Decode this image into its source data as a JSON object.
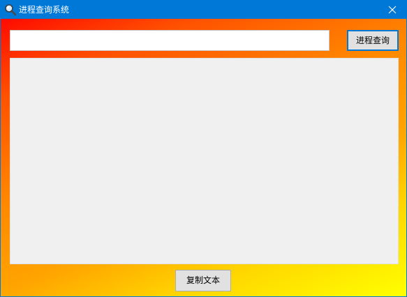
{
  "window": {
    "title": "进程查询系统",
    "icon": "magnifier-icon",
    "close_icon": "close-icon"
  },
  "query": {
    "input_value": "",
    "button_label": "进程查询"
  },
  "result": {
    "text": ""
  },
  "actions": {
    "copy_label": "复制文本"
  },
  "colors": {
    "titlebar": "#0078d7",
    "gradient_start": "#ff0a00",
    "gradient_mid": "#ff8800",
    "gradient_end": "#ffff00",
    "result_background": "#f0f0f0"
  }
}
